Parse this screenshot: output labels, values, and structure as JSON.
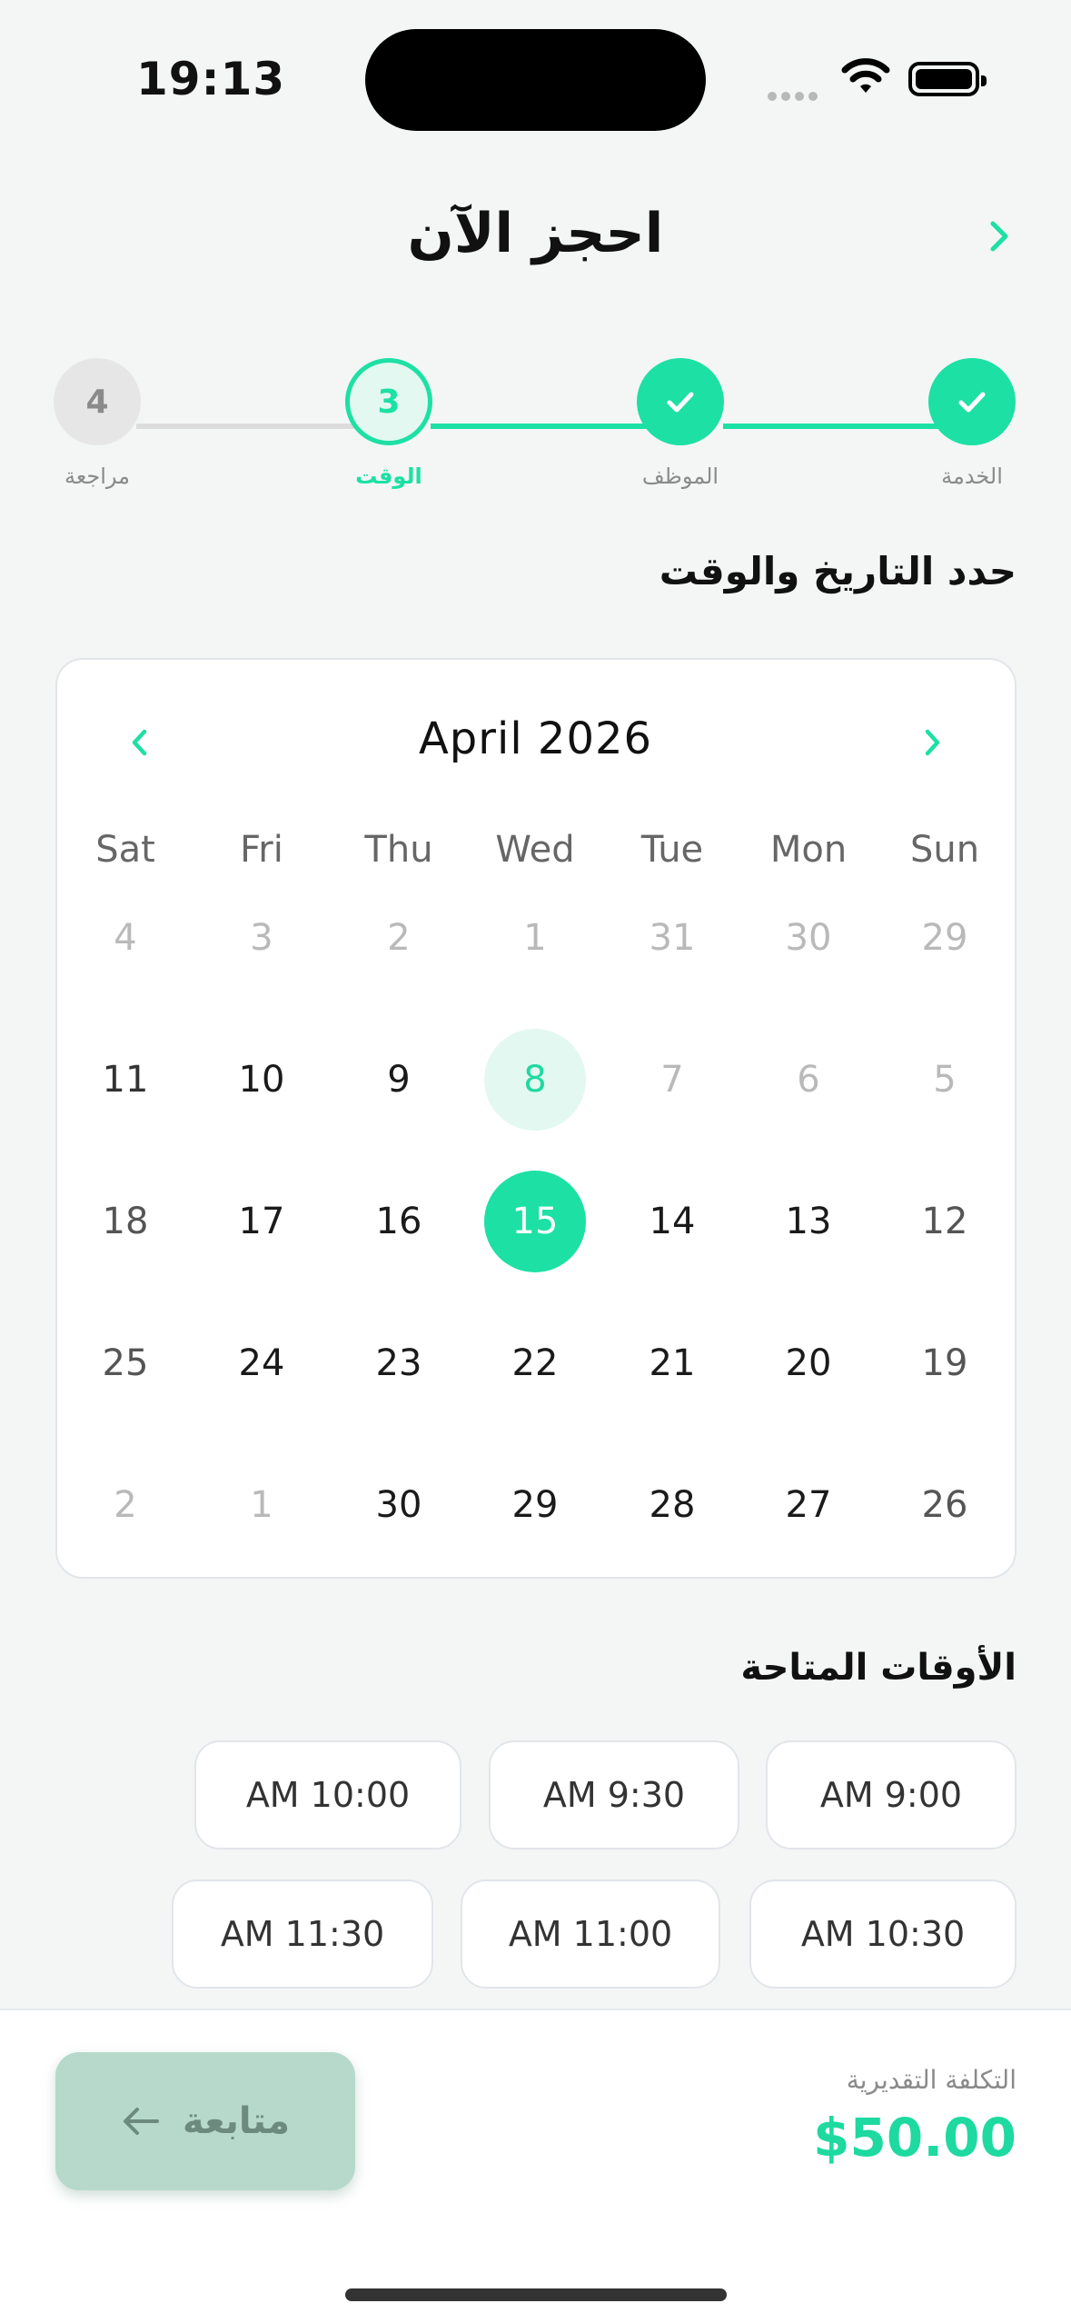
{
  "status_bar": {
    "time": "19:13"
  },
  "header": {
    "title": "احجز الآن"
  },
  "stepper": {
    "steps": [
      {
        "label": "الخدمة",
        "state": "done"
      },
      {
        "label": "الموظف",
        "state": "done"
      },
      {
        "label": "الوقت",
        "number": "3",
        "state": "active"
      },
      {
        "label": "مراجعة",
        "number": "4",
        "state": "pending"
      }
    ]
  },
  "date_section": {
    "title": "حدد التاريخ والوقت"
  },
  "calendar": {
    "month_label": "April 2026",
    "weekdays": [
      "Sun",
      "Mon",
      "Tue",
      "Wed",
      "Thu",
      "Fri",
      "Sat"
    ],
    "weeks": [
      [
        "29",
        "30",
        "31",
        "1",
        "2",
        "3",
        "4"
      ],
      [
        "5",
        "6",
        "7",
        "8",
        "9",
        "10",
        "11"
      ],
      [
        "12",
        "13",
        "14",
        "15",
        "16",
        "17",
        "18"
      ],
      [
        "19",
        "20",
        "21",
        "22",
        "23",
        "24",
        "25"
      ],
      [
        "26",
        "27",
        "28",
        "29",
        "30",
        "1",
        "2"
      ]
    ],
    "today": "8",
    "selected": "15"
  },
  "times_section": {
    "title": "الأوقات المتاحة",
    "slots": [
      "AM 9:00",
      "AM 9:30",
      "AM 10:00",
      "AM 10:30",
      "AM 11:00",
      "AM 11:30"
    ]
  },
  "footer": {
    "cost_label": "التكلفة التقديرية",
    "cost_value": "$50.00",
    "continue_label": "متابعة"
  },
  "colors": {
    "accent": "#1de0a4",
    "accent_light": "#e3f8f0",
    "disabled_button": "#b6d9cb"
  }
}
